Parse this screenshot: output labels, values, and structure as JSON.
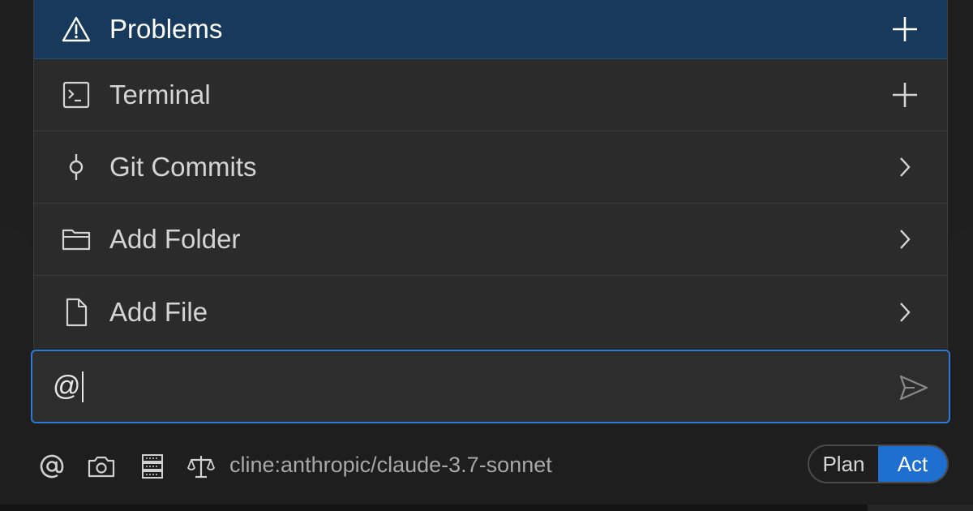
{
  "mention_menu": {
    "items": [
      {
        "label": "Problems",
        "icon": "warning-icon",
        "action": "plus-icon",
        "selected": true
      },
      {
        "label": "Terminal",
        "icon": "terminal-icon",
        "action": "plus-icon",
        "selected": false
      },
      {
        "label": "Git Commits",
        "icon": "git-commit-icon",
        "action": "chevron-right-icon",
        "selected": false
      },
      {
        "label": "Add Folder",
        "icon": "folder-icon",
        "action": "chevron-right-icon",
        "selected": false
      },
      {
        "label": "Add File",
        "icon": "file-icon",
        "action": "chevron-right-icon",
        "selected": false
      }
    ]
  },
  "chat_input": {
    "value": "@",
    "send_icon": "send-icon"
  },
  "toolbar": {
    "icons": [
      "at-icon",
      "camera-icon",
      "server-icon",
      "scale-icon"
    ],
    "model": "cline:anthropic/claude-3.7-sonnet"
  },
  "mode_toggle": {
    "options": [
      "Plan",
      "Act"
    ],
    "active": "Act"
  },
  "colors": {
    "selected_bg": "#173a5c",
    "focus_border": "#2f7ad6",
    "toggle_active": "#1f6fd0"
  }
}
